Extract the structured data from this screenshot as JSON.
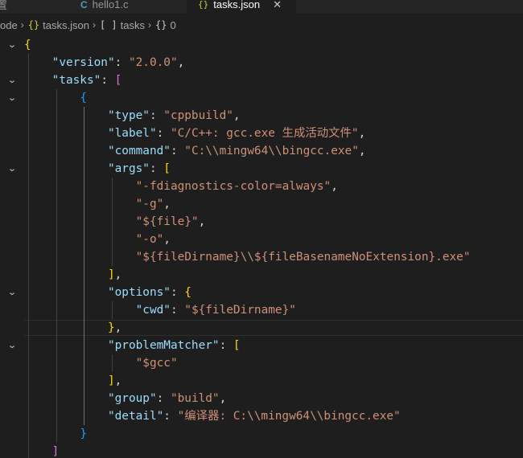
{
  "tabs": [
    {
      "label": "置",
      "icon": "settings-file-icon",
      "active": false
    },
    {
      "label": "hello1.c",
      "icon": "c-file-icon",
      "icon_glyph": "C",
      "active": false
    },
    {
      "label": "tasks.json",
      "icon": "json-file-icon",
      "icon_glyph": "{}",
      "active": true,
      "close_glyph": "✕"
    }
  ],
  "breadcrumb": {
    "items": [
      {
        "label": "ode",
        "icon_glyph": ""
      },
      {
        "label": "tasks.json",
        "icon_glyph": "{}"
      },
      {
        "label": "tasks",
        "icon_glyph": "[ ]"
      },
      {
        "label": "0",
        "icon_glyph": "{}"
      }
    ],
    "separator": "›"
  },
  "fold_glyph": "⌄",
  "code": [
    [
      [
        "b1",
        "{"
      ]
    ],
    [
      [
        "p",
        "    "
      ],
      [
        "k",
        "\"version\""
      ],
      [
        "p",
        ": "
      ],
      [
        "s",
        "\"2.0.0\""
      ],
      [
        "p",
        ","
      ]
    ],
    [
      [
        "p",
        "    "
      ],
      [
        "k",
        "\"tasks\""
      ],
      [
        "p",
        ": "
      ],
      [
        "b2",
        "["
      ]
    ],
    [
      [
        "p",
        "        "
      ],
      [
        "b3",
        "{"
      ]
    ],
    [
      [
        "p",
        "            "
      ],
      [
        "k",
        "\"type\""
      ],
      [
        "p",
        ": "
      ],
      [
        "s",
        "\"cppbuild\""
      ],
      [
        "p",
        ","
      ]
    ],
    [
      [
        "p",
        "            "
      ],
      [
        "k",
        "\"label\""
      ],
      [
        "p",
        ": "
      ],
      [
        "s",
        "\"C/C++: gcc.exe 生成活动文件\""
      ],
      [
        "p",
        ","
      ]
    ],
    [
      [
        "p",
        "            "
      ],
      [
        "k",
        "\"command\""
      ],
      [
        "p",
        ": "
      ],
      [
        "s",
        "\"C:\\\\mingw64\\\\bingcc.exe\""
      ],
      [
        "p",
        ","
      ]
    ],
    [
      [
        "p",
        "            "
      ],
      [
        "k",
        "\"args\""
      ],
      [
        "p",
        ": "
      ],
      [
        "b1",
        "["
      ]
    ],
    [
      [
        "p",
        "                "
      ],
      [
        "s",
        "\"-fdiagnostics-color=always\""
      ],
      [
        "p",
        ","
      ]
    ],
    [
      [
        "p",
        "                "
      ],
      [
        "s",
        "\"-g\""
      ],
      [
        "p",
        ","
      ]
    ],
    [
      [
        "p",
        "                "
      ],
      [
        "s",
        "\"${file}\""
      ],
      [
        "p",
        ","
      ]
    ],
    [
      [
        "p",
        "                "
      ],
      [
        "s",
        "\"-o\""
      ],
      [
        "p",
        ","
      ]
    ],
    [
      [
        "p",
        "                "
      ],
      [
        "s",
        "\"${fileDirname}\\\\${fileBasenameNoExtension}.exe\""
      ]
    ],
    [
      [
        "p",
        "            "
      ],
      [
        "b1",
        "]"
      ],
      [
        "p",
        ","
      ]
    ],
    [
      [
        "p",
        "            "
      ],
      [
        "k",
        "\"options\""
      ],
      [
        "p",
        ": "
      ],
      [
        "b1",
        "{"
      ]
    ],
    [
      [
        "p",
        "                "
      ],
      [
        "k",
        "\"cwd\""
      ],
      [
        "p",
        ": "
      ],
      [
        "s",
        "\"${fileDirname}\""
      ]
    ],
    [
      [
        "p",
        "            "
      ],
      [
        "b1",
        "}"
      ],
      [
        "p",
        ","
      ]
    ],
    [
      [
        "p",
        "            "
      ],
      [
        "k",
        "\"problemMatcher\""
      ],
      [
        "p",
        ": "
      ],
      [
        "b1",
        "["
      ]
    ],
    [
      [
        "p",
        "                "
      ],
      [
        "s",
        "\"$gcc\""
      ]
    ],
    [
      [
        "p",
        "            "
      ],
      [
        "b1",
        "]"
      ],
      [
        "p",
        ","
      ]
    ],
    [
      [
        "p",
        "            "
      ],
      [
        "k",
        "\"group\""
      ],
      [
        "p",
        ": "
      ],
      [
        "s",
        "\"build\""
      ],
      [
        "p",
        ","
      ]
    ],
    [
      [
        "p",
        "            "
      ],
      [
        "k",
        "\"detail\""
      ],
      [
        "p",
        ": "
      ],
      [
        "s",
        "\"编译器: C:\\\\mingw64\\\\bingcc.exe\""
      ]
    ],
    [
      [
        "p",
        "        "
      ],
      [
        "b3",
        "}"
      ]
    ],
    [
      [
        "p",
        "    "
      ],
      [
        "b2",
        "]"
      ]
    ]
  ]
}
